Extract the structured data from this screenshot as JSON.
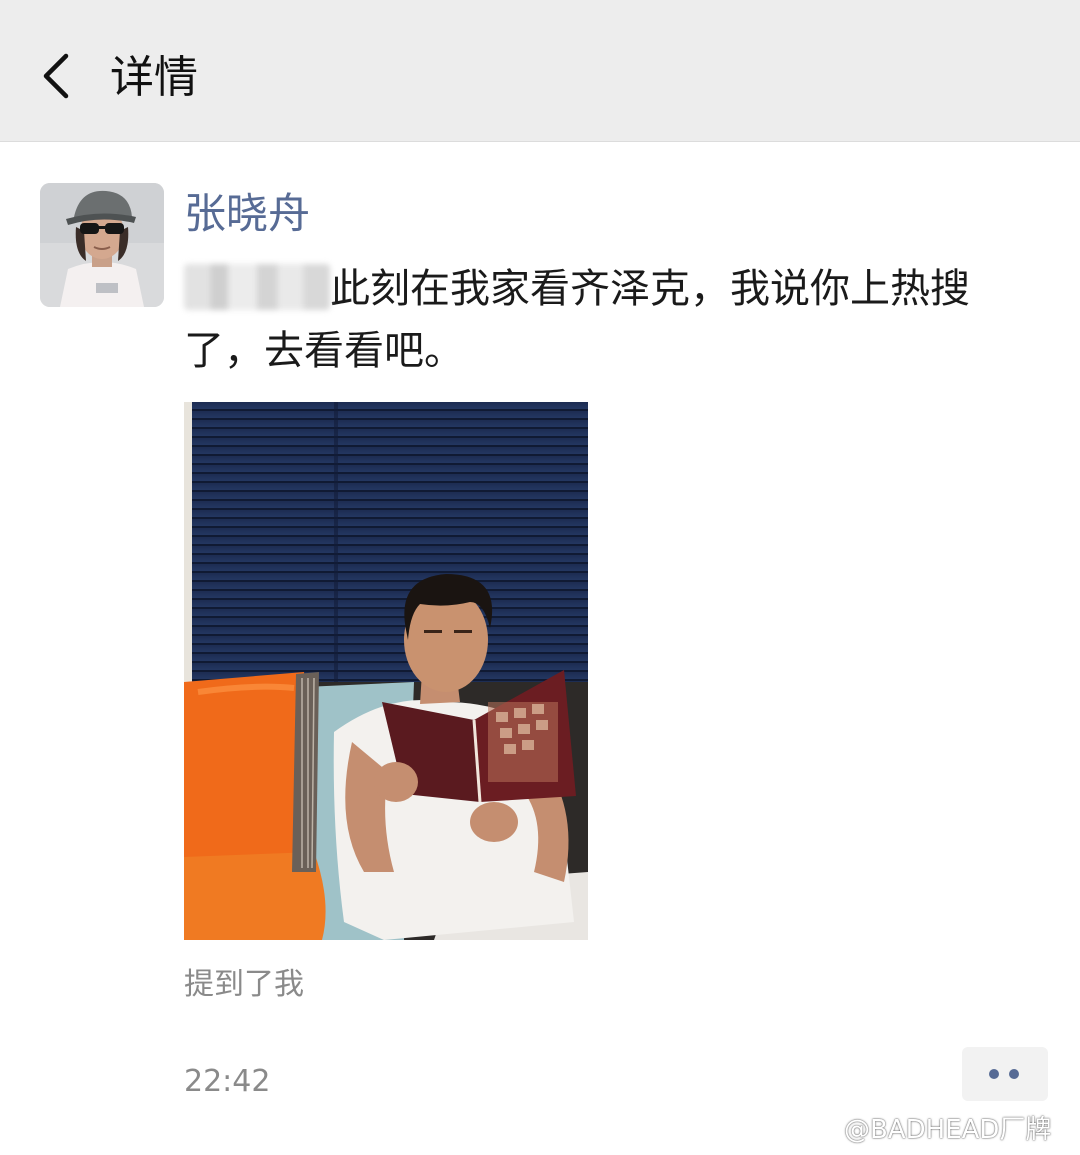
{
  "header": {
    "title": "详情",
    "back_icon": "chevron-left-icon"
  },
  "post": {
    "author": "张晓舟",
    "text": "此刻在我家看齐泽克，我说你上热搜了，去看看吧。",
    "mention": "提到了我",
    "time": "22:42",
    "more_icon": "more-dots-icon"
  },
  "watermark": {
    "text": "@BADHEAD厂牌",
    "icon": "weibo-icon"
  },
  "colors": {
    "header_bg": "#ededed",
    "author_link": "#576b95",
    "meta_text": "#8a8a8a"
  }
}
